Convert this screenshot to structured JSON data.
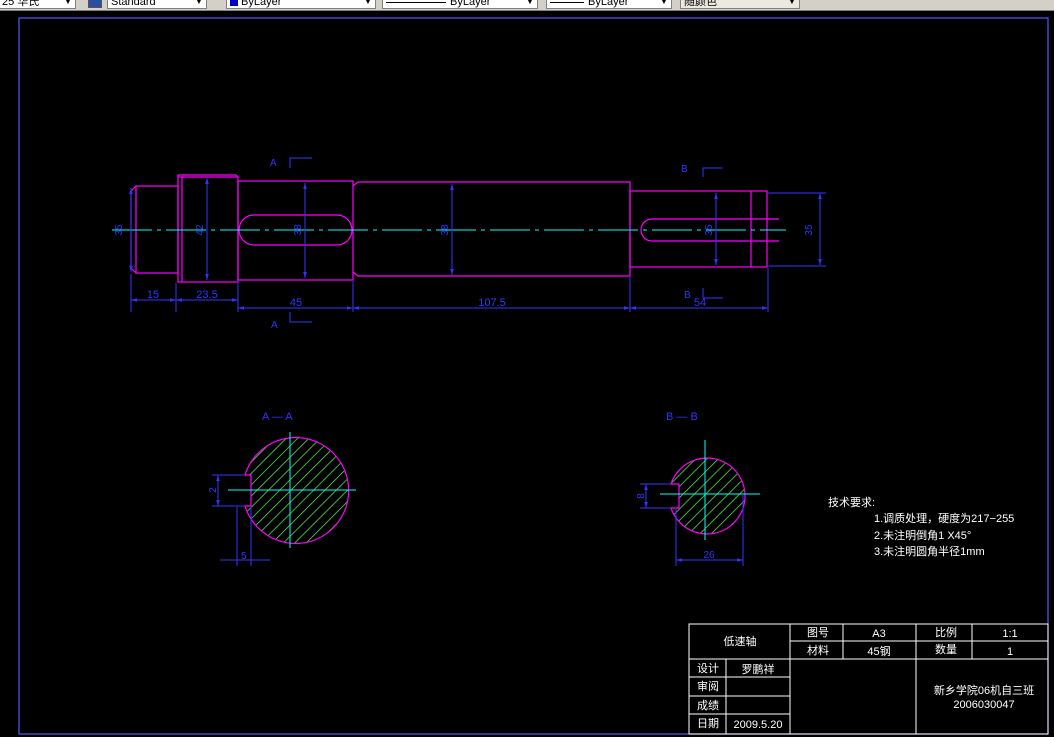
{
  "toolbar": {
    "dimstyle": "25 华氏",
    "textstyle": "Standard",
    "layer": "ByLayer",
    "linetype": "ByLayer",
    "lineweight": "ByLayer",
    "plotstyle": "随颜色"
  },
  "colors": {
    "background": "#000000",
    "outline": "#ff00ff",
    "dimension": "#3333ff",
    "centerline": "#00ffff",
    "hatch": "#55ff55",
    "text": "#ffffff"
  },
  "shaft_view": {
    "diameters": [
      "35",
      "42",
      "38",
      "38",
      "35",
      "35"
    ],
    "lengths": [
      "15",
      "23.5",
      "45",
      "107.5",
      "54"
    ],
    "section_a_label": "A",
    "section_b_label": "B"
  },
  "section_aa": {
    "title": "A — A",
    "depth": "2",
    "width": "5"
  },
  "section_bb": {
    "title": "B — B",
    "depth": "8",
    "width": "26"
  },
  "tech_requirements": {
    "heading": "技术要求:",
    "items": [
      "1.调质处理，硬度为217−255",
      "2.未注明倒角1 X45°",
      "3.未注明圆角半径1mm"
    ]
  },
  "title_block": {
    "part_name": "低速轴",
    "drawing_no_label": "图号",
    "drawing_no": "A3",
    "scale_label": "比例",
    "scale": "1:1",
    "material_label": "材料",
    "material": "45钢",
    "quantity_label": "数量",
    "quantity": "1",
    "design_label": "设计",
    "designer": "罗鹏祥",
    "review_label": "审阅",
    "grade_label": "成绩",
    "date_label": "日期",
    "date": "2009.5.20",
    "school": "新乡学院06机自三班",
    "student_id": "2006030047"
  }
}
